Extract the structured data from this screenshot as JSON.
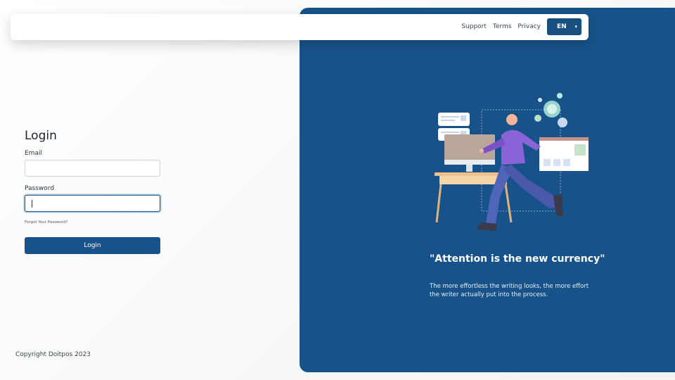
{
  "header": {
    "links": [
      "Support",
      "Terms",
      "Privacy"
    ],
    "language": {
      "selected": "EN"
    }
  },
  "login": {
    "title": "Login",
    "email_label": "Email",
    "email_value": "",
    "password_label": "Password",
    "password_value": "",
    "forgot_label": "Forgot Your Password?",
    "submit_label": "Login"
  },
  "footer": {
    "copyright": "Copyright Doitpos 2023"
  },
  "promo": {
    "quote": "\"Attention is the new currency\"",
    "subtext": "The more effortless the writing looks, the more effort the writer actually put into the process."
  },
  "colors": {
    "brand_blue": "#17538a",
    "background": "#f5f6f7"
  }
}
